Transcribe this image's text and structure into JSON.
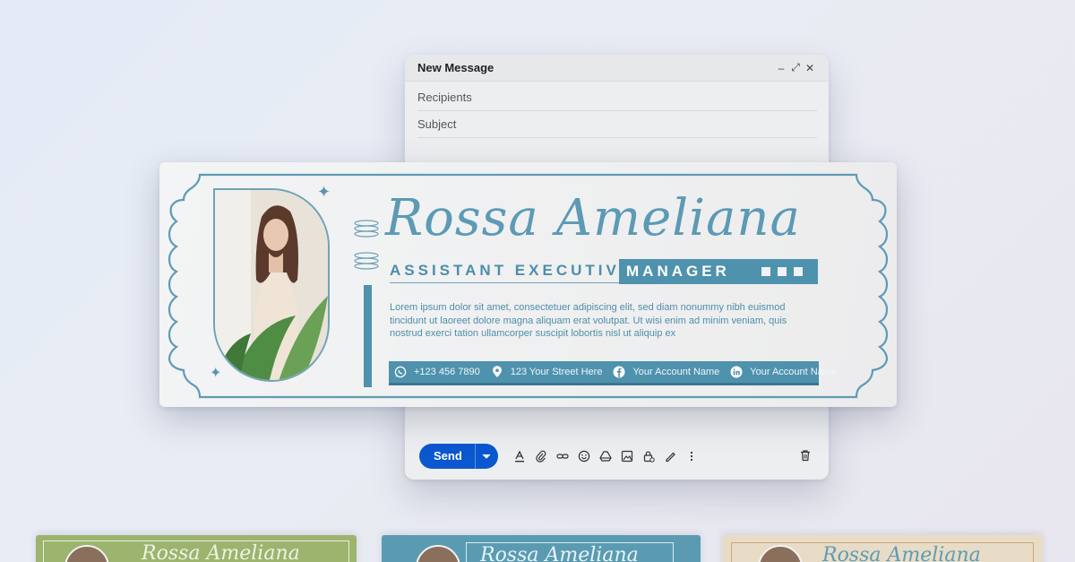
{
  "compose": {
    "title": "New Message",
    "minimize": "–",
    "expand": "⤢",
    "close": "✕",
    "recipients_placeholder": "Recipients",
    "subject_placeholder": "Subject",
    "send_label": "Send"
  },
  "signature": {
    "name": "Rossa Ameliana",
    "role_left": "ASSISTANT EXECUTIVE",
    "role_right": "MANAGER",
    "body": "Lorem ipsum dolor sit amet, consectetuer adipiscing elit, sed diam nonummy nibh euismod tincidunt ut laoreet dolore magna aliquam erat volutpat. Ut wisi enim ad minim veniam, quis nostrud exerci tation ullamcorper suscipit lobortis nisl ut aliquip ex",
    "phone": "+123 456 7890",
    "address": "123 Your Street Here",
    "facebook": "Your Account Name",
    "linkedin": "Your Account Name"
  },
  "colors": {
    "accent": "#4f92ad",
    "send_button": "#0b57d0",
    "preview_green": "#9cb46e",
    "preview_teal": "#5a9bb2",
    "preview_beige": "#e8dcc6"
  },
  "previews": [
    {
      "name": "Rossa Ameliana"
    },
    {
      "name": "Rossa Ameliana"
    },
    {
      "name": "Rossa Ameliana"
    }
  ]
}
